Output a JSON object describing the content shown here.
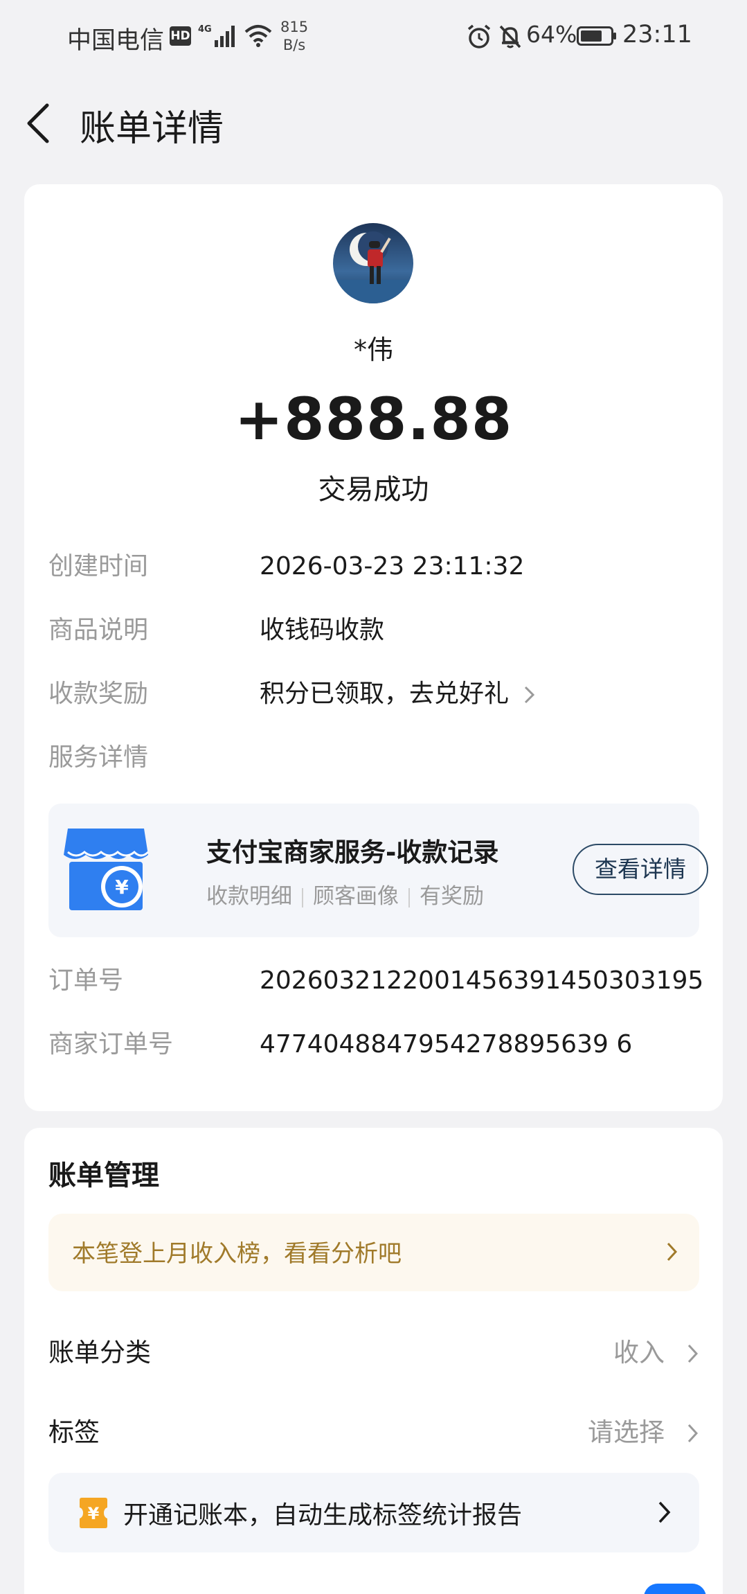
{
  "status_bar": {
    "carrier": "中国电信",
    "hd": "HD",
    "network": "4G",
    "speed_value": "815",
    "speed_unit": "B/s",
    "battery": "64%",
    "time": "23:11"
  },
  "header": {
    "title": "账单详情"
  },
  "transaction": {
    "name": "*伟",
    "amount": "+888.88",
    "status": "交易成功",
    "details": [
      {
        "label": "创建时间",
        "value": "2026-03-23 23:11:32"
      },
      {
        "label": "商品说明",
        "value": "收钱码收款"
      },
      {
        "label": "收款奖励",
        "value": "积分已领取，去兑好礼"
      },
      {
        "label": "服务详情",
        "value": ""
      }
    ],
    "service": {
      "title": "支付宝商家服务-收款记录",
      "tags": [
        "收款明细",
        "顾客画像",
        "有奖励"
      ],
      "button": "查看详情"
    },
    "order_no_label": "订单号",
    "order_no": "2026032122001456391450303195",
    "merchant_order_label": "商家订单号",
    "merchant_order_no": "4774048847954278895639 6"
  },
  "management": {
    "title": "账单管理",
    "tip": "本笔登上月收入榜，看看分析吧",
    "category_label": "账单分类",
    "category_value": "收入",
    "tag_label": "标签",
    "tag_value": "请选择",
    "promo": "开通记账本，自动生成标签统计报告",
    "promo_icon_char": "¥"
  },
  "colors": {
    "page_bg": "#f2f2f4",
    "card_bg": "#ffffff",
    "accent_blue": "#1677ff",
    "tip_text": "#a07a2a",
    "tip_bg": "#fdf8ef",
    "muted": "#9a9a9a"
  }
}
